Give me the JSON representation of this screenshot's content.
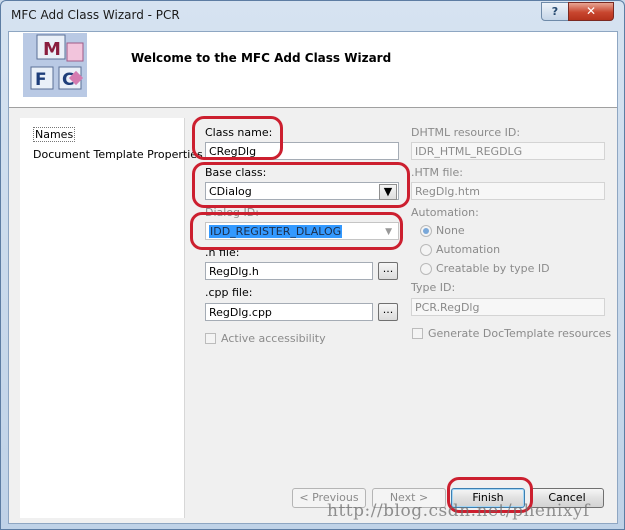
{
  "window": {
    "title": "MFC Add Class Wizard - PCR",
    "help_glyph": "?",
    "close_glyph": "✕"
  },
  "header": {
    "title": "Welcome to the MFC Add Class Wizard",
    "logo_letters": [
      "M",
      "F",
      "C"
    ]
  },
  "nav": {
    "items": [
      {
        "label": "Names",
        "selected": true
      },
      {
        "label": "Document Template Properties",
        "selected": false
      }
    ]
  },
  "form": {
    "class_name": {
      "label": "Class name:",
      "value": "CRegDlg"
    },
    "base_class": {
      "label": "Base class:",
      "value": "CDialog"
    },
    "dialog_id": {
      "label": "Dialog ID:",
      "value": "IDD_REGISTER_DLALOG"
    },
    "h_file": {
      "label": ".h file:",
      "value": "RegDlg.h",
      "browse": "..."
    },
    "cpp_file": {
      "label": ".cpp file:",
      "value": "RegDlg.cpp",
      "browse": "..."
    },
    "active_accessibility": {
      "label": "Active accessibility",
      "checked": false
    },
    "dhtml_resource_id": {
      "label": "DHTML resource ID:",
      "value": "IDR_HTML_REGDLG"
    },
    "htm_file": {
      "label": ".HTM file:",
      "value": "RegDlg.htm"
    },
    "automation": {
      "label": "Automation:",
      "options": [
        {
          "label": "None",
          "selected": true
        },
        {
          "label": "Automation",
          "selected": false
        },
        {
          "label": "Creatable by type ID",
          "selected": false
        }
      ]
    },
    "type_id": {
      "label": "Type ID:",
      "value": "PCR.RegDlg"
    },
    "generate_doctemplate": {
      "label": "Generate DocTemplate resources",
      "checked": false
    }
  },
  "buttons": {
    "previous": "< Previous",
    "next": "Next >",
    "finish": "Finish",
    "cancel": "Cancel"
  },
  "watermark": "http://blog.csdn.net/phenixyf",
  "colors": {
    "highlight_ring": "#cc1f2f",
    "selection": "#3399ff"
  }
}
